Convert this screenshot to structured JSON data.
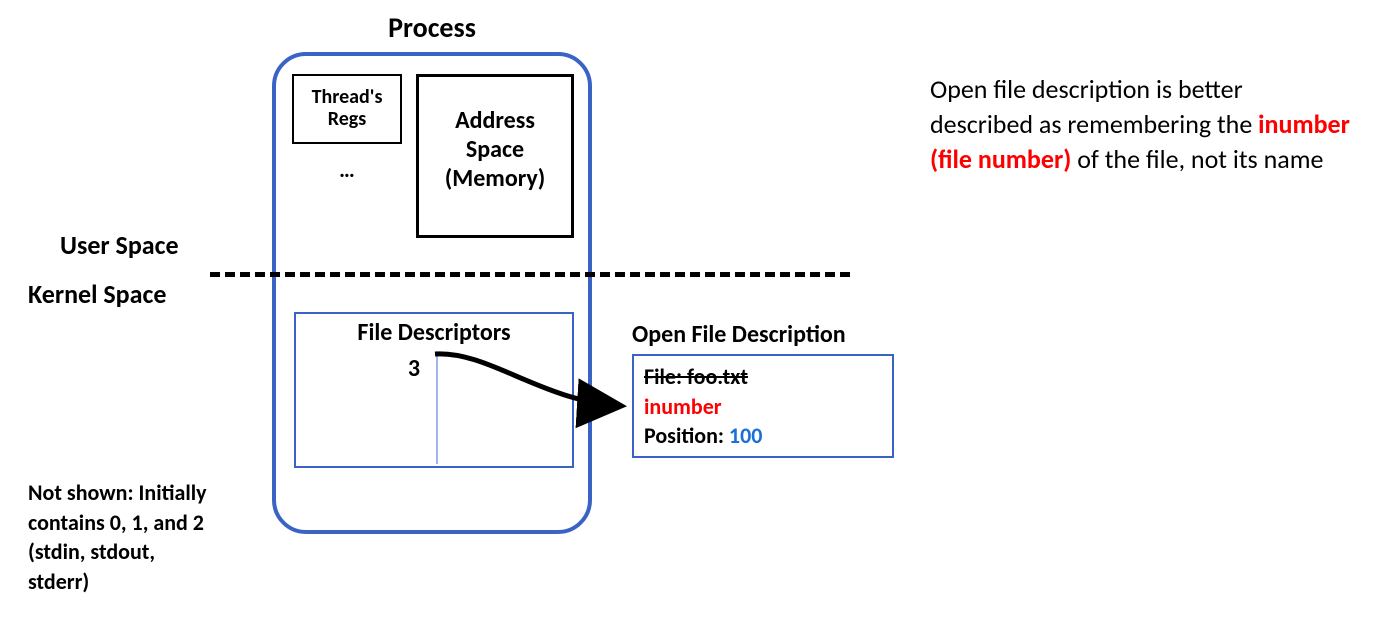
{
  "title": "Process",
  "thread_regs_line1": "Thread's",
  "thread_regs_line2": "Regs",
  "ellipsis": "…",
  "addr_line1": "Address",
  "addr_line2": "Space",
  "addr_line3": "(Memory)",
  "user_label": "User Space",
  "kernel_label": "Kernel Space",
  "fd_title": "File Descriptors",
  "fd_number": "3",
  "ofd_title": "Open File Description",
  "ofd_file_label": "File: foo.txt",
  "ofd_inumber": "inumber",
  "ofd_position_label": "Position: ",
  "ofd_position_value": "100",
  "note_line1": "Not shown: Initially",
  "note_line2": "contains 0, 1, and 2",
  "note_line3": "(stdin, stdout,",
  "note_line4": "stderr)",
  "explain_pre": "Open file description is better described as remembering the ",
  "explain_red": "inumber (file number)",
  "explain_post": " of the file, not its name"
}
